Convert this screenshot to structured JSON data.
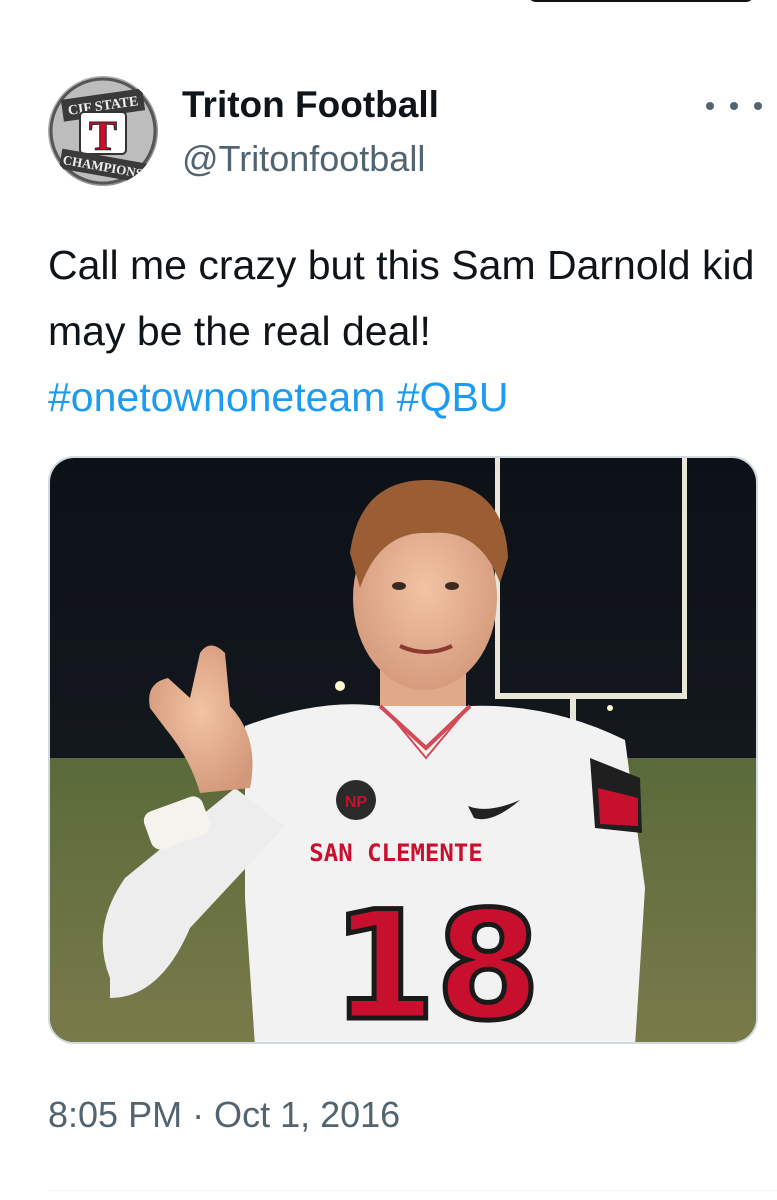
{
  "tweet": {
    "author": {
      "display_name": "Triton Football",
      "handle": "@Tritonfootball",
      "avatar_text_top": "CIF STATE",
      "avatar_letter": "T",
      "avatar_text_bottom": "CHAMPIONS"
    },
    "text_plain": "Call me crazy but this Sam Darnold kid may be the real deal! ",
    "hashtags": [
      "#onetownoneteam",
      "#QBU"
    ],
    "timestamp": "8:05 PM · Oct 1, 2016",
    "media": {
      "jersey_team": "SAN CLEMENTE",
      "jersey_number": "18",
      "patch_text": "NP"
    }
  },
  "icons": {
    "more": "more-horizontal-icon"
  },
  "colors": {
    "link": "#1d9bf0",
    "secondary_text": "#536471",
    "primary_text": "#0f1419"
  }
}
